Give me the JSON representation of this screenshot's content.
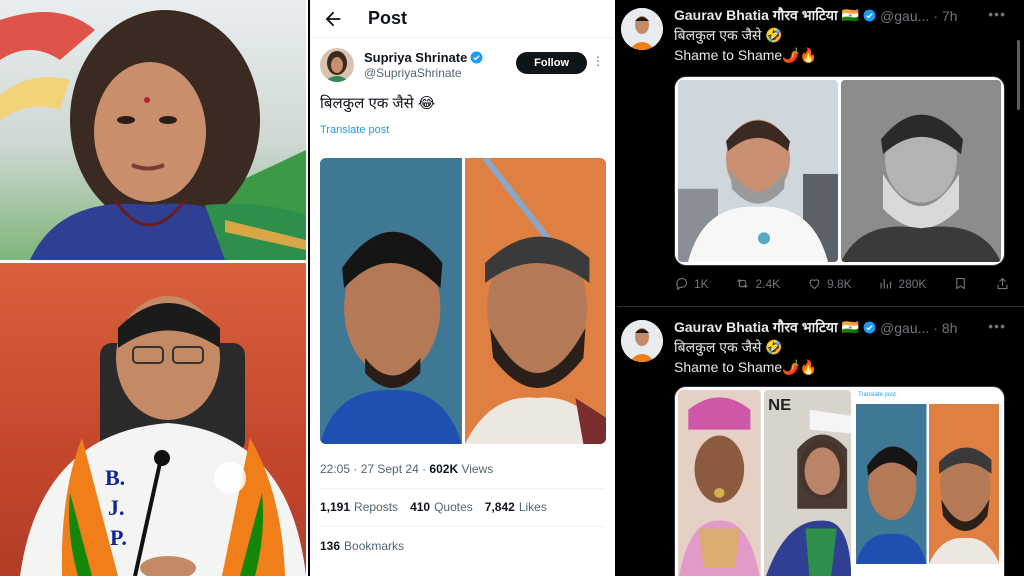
{
  "light_post": {
    "header_title": "Post",
    "author_name": "Supriya Shrinate",
    "author_handle": "@SupriyaShrinate",
    "follow_label": "Follow",
    "text": "बिलकुल एक जैसे 😂",
    "translate_label": "Translate post",
    "time": "22:05 · 27 Sept 24 ·",
    "views_count": "602K",
    "views_label": "Views",
    "reposts_count": "1,191",
    "reposts_label": "Reposts",
    "quotes_count": "410",
    "quotes_label": "Quotes",
    "likes_count": "7,842",
    "likes_label": "Likes",
    "bookmarks_count": "136",
    "bookmarks_label": "Bookmarks"
  },
  "dark_tweets": [
    {
      "name": "Gaurav Bhatia गौरव भाटिया",
      "flag": "🇮🇳",
      "handle": "@gau...",
      "time": "· 7h",
      "line1": "बिलकुल एक जैसे 🤣",
      "line2": "Shame to Shame🌶️🔥",
      "replies": "1K",
      "retweets": "2.4K",
      "likes": "9.8K",
      "views": "280K"
    },
    {
      "name": "Gaurav Bhatia गौरव भाटिया",
      "flag": "🇮🇳",
      "handle": "@gau...",
      "time": "· 8h",
      "line1": "बिलकुल एक जैसे 🤣",
      "line2": "Shame to Shame🌶️🔥",
      "embedded_translate": "Translate post"
    }
  ],
  "colors": {
    "accent_blue": "#1d9bf0",
    "dark_bg": "#000000",
    "dark_text": "#e7e9ea",
    "muted": "#71767b",
    "bjp_saffron": "#f07f1a",
    "bjp_green": "#138808"
  },
  "icons": {
    "back": "arrow-left-icon",
    "verified": "verified-badge-icon",
    "reply": "reply-icon",
    "retweet": "retweet-icon",
    "like": "heart-icon",
    "views": "views-chart-icon",
    "bookmark": "bookmark-icon",
    "share": "share-icon"
  },
  "photo_text": {
    "scarf_letters": "B. J. P."
  }
}
